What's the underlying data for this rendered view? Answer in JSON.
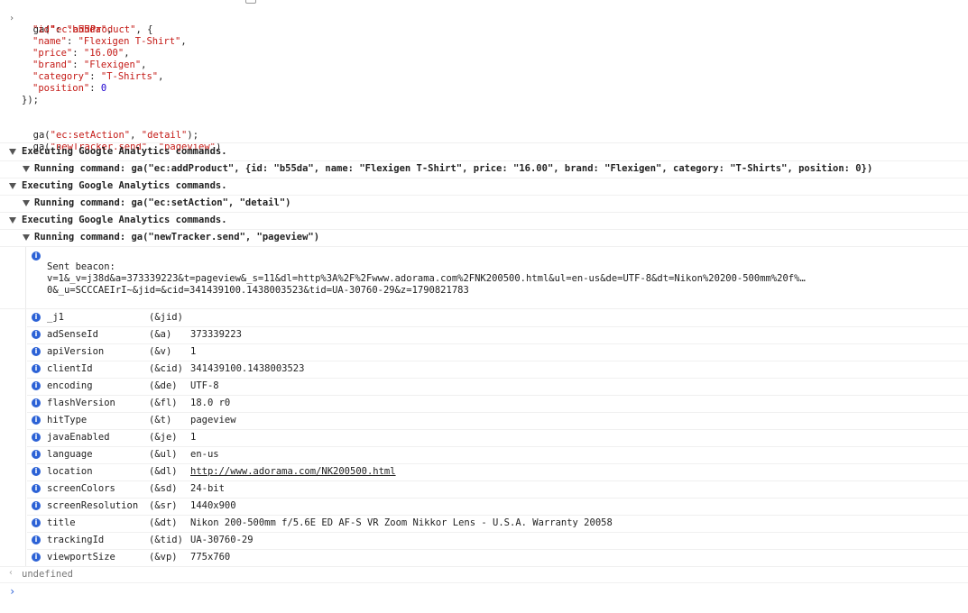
{
  "code": {
    "line1_prefix": "ga(",
    "line1_arg": "\"ec:addProduct\"",
    "line1_suffix": ", {",
    "props": [
      {
        "key": "\"id\"",
        "value": "\"b55da\"",
        "type": "str",
        "comma": ","
      },
      {
        "key": "\"name\"",
        "value": "\"Flexigen T-Shirt\"",
        "type": "str",
        "comma": ","
      },
      {
        "key": "\"price\"",
        "value": "\"16.00\"",
        "type": "str",
        "comma": ","
      },
      {
        "key": "\"brand\"",
        "value": "\"Flexigen\"",
        "type": "str",
        "comma": ","
      },
      {
        "key": "\"category\"",
        "value": "\"T-Shirts\"",
        "type": "str",
        "comma": ","
      },
      {
        "key": "\"position\"",
        "value": "0",
        "type": "num",
        "comma": ""
      }
    ],
    "close": "});",
    "line_set_prefix": "ga(",
    "line_set_arg1": "\"ec:setAction\"",
    "line_set_mid": ", ",
    "line_set_arg2": "\"detail\"",
    "line_set_suffix": ");",
    "line_send_prefix": "ga(",
    "line_send_arg1": "\"newTracker.send\"",
    "line_send_mid": ", ",
    "line_send_arg2": "\"pageview\"",
    "line_send_suffix": ")"
  },
  "groups": [
    {
      "title": "Executing Google Analytics commands.",
      "command": "Running command: ga(\"ec:addProduct\", {id: \"b55da\", name: \"Flexigen T-Shirt\", price: \"16.00\", brand: \"Flexigen\", category: \"T-Shirts\", position: 0})"
    },
    {
      "title": "Executing Google Analytics commands.",
      "command": "Running command: ga(\"ec:setAction\", \"detail\")"
    },
    {
      "title": "Executing Google Analytics commands.",
      "command": "Running command: ga(\"newTracker.send\", \"pageview\")"
    }
  ],
  "beacon": {
    "label": "Sent beacon:",
    "line1": "v=1&_v=j38d&a=373339223&t=pageview&_s=11&dl=http%3A%2F%2Fwww.adorama.com%2FNK200500.html&ul=en-us&de=UTF-8&dt=Nikon%20200-500mm%20f%…",
    "line2": "0&_u=SCCCAEIrI~&jid=&cid=341439100.1438003523&tid=UA-30760-29&z=1790821783"
  },
  "fields": [
    {
      "name": "_j1",
      "param": "(&jid)",
      "value": ""
    },
    {
      "name": "adSenseId",
      "param": "(&a)",
      "value": "373339223"
    },
    {
      "name": "apiVersion",
      "param": "(&v)",
      "value": "1"
    },
    {
      "name": "clientId",
      "param": "(&cid)",
      "value": "341439100.1438003523"
    },
    {
      "name": "encoding",
      "param": "(&de)",
      "value": "UTF-8"
    },
    {
      "name": "flashVersion",
      "param": "(&fl)",
      "value": "18.0 r0"
    },
    {
      "name": "hitType",
      "param": "(&t)",
      "value": "pageview"
    },
    {
      "name": "javaEnabled",
      "param": "(&je)",
      "value": "1"
    },
    {
      "name": "language",
      "param": "(&ul)",
      "value": "en-us"
    },
    {
      "name": "location",
      "param": "(&dl)",
      "value": "http://www.adorama.com/NK200500.html"
    },
    {
      "name": "screenColors",
      "param": "(&sd)",
      "value": "24-bit"
    },
    {
      "name": "screenResolution",
      "param": "(&sr)",
      "value": "1440x900"
    },
    {
      "name": "title",
      "param": "(&dt)",
      "value": "Nikon 200-500mm f/5.6E ED AF-S VR Zoom Nikkor Lens - U.S.A. Warranty 20058"
    },
    {
      "name": "trackingId",
      "param": "(&tid)",
      "value": "UA-30760-29"
    },
    {
      "name": "viewportSize",
      "param": "(&vp)",
      "value": "775x760"
    }
  ],
  "result": {
    "arrow": "‹",
    "text": "undefined"
  },
  "prompt": {
    "symbol": "›"
  },
  "icons": {
    "info": "i",
    "input_prompt": "›"
  },
  "colors": {
    "info_icon": "#2c62d6",
    "string": "#c41a16",
    "number": "#1c00cf",
    "key": "#881280"
  }
}
